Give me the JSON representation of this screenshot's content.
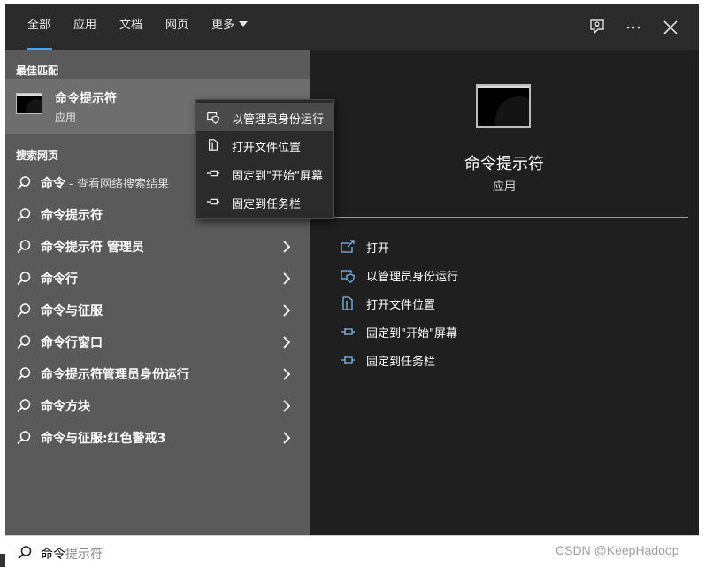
{
  "tabs": [
    {
      "label": "全部"
    },
    {
      "label": "应用"
    },
    {
      "label": "文档"
    },
    {
      "label": "网页"
    },
    {
      "label": "更多"
    }
  ],
  "best_match": {
    "header": "最佳匹配",
    "title": "命令提示符",
    "subtitle": "应用"
  },
  "web": {
    "header": "搜索网页",
    "items": [
      {
        "bold": "命令",
        "dim": " - 查看网络搜索结果"
      },
      {
        "bold": "命令提示符"
      },
      {
        "bold": "命令提示符 管理员"
      },
      {
        "bold": "命令行"
      },
      {
        "bold": "命令与征服"
      },
      {
        "bold": "命令行窗口"
      },
      {
        "bold": "命令提示符管理员身份运行"
      },
      {
        "bold": "命令方块"
      },
      {
        "bold": "命令与征服:红色警戒3"
      }
    ]
  },
  "context_menu": [
    {
      "label": "以管理员身份运行",
      "icon": "shield-icon"
    },
    {
      "label": "打开文件位置",
      "icon": "file-location-icon"
    },
    {
      "label": "固定到\"开始\"屏幕",
      "icon": "pin-icon"
    },
    {
      "label": "固定到任务栏",
      "icon": "pin-icon"
    }
  ],
  "detail": {
    "title": "命令提示符",
    "subtitle": "应用",
    "actions": [
      {
        "label": "打开",
        "icon": "open-icon"
      },
      {
        "label": "以管理员身份运行",
        "icon": "shield-icon"
      },
      {
        "label": "打开文件位置",
        "icon": "file-location-icon"
      },
      {
        "label": "固定到\"开始\"屏幕",
        "icon": "pin-icon"
      },
      {
        "label": "固定到任务栏",
        "icon": "pin-icon"
      }
    ]
  },
  "search": {
    "typed": "命令",
    "suggestion": "提示符"
  },
  "watermark": "CSDN @KeepHadoop",
  "colors": {
    "accent": "#4aa0f0",
    "left_panel": "#5a5a5a",
    "right_panel": "#1f1f1f",
    "context_menu": "#2b2b2b"
  }
}
